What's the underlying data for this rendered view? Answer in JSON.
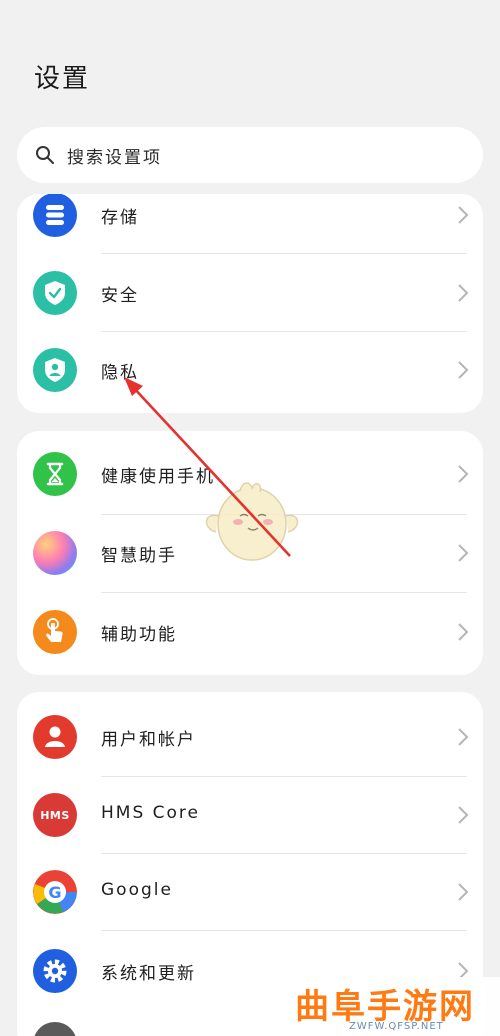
{
  "page": {
    "title": "设置"
  },
  "search": {
    "placeholder": "搜索设置项",
    "icon": "search-icon"
  },
  "group1": [
    {
      "label": "存储",
      "icon": "storage-icon",
      "color": "#1f5fe0"
    },
    {
      "label": "安全",
      "icon": "shield-check-icon",
      "color": "#2bbfa6"
    },
    {
      "label": "隐私",
      "icon": "privacy-shield-icon",
      "color": "#2bbfa6"
    }
  ],
  "group2": [
    {
      "label": "健康使用手机",
      "icon": "hourglass-icon",
      "color": "#31c24a"
    },
    {
      "label": "智慧助手",
      "icon": "assistant-orb-icon",
      "color": "#8a7cf0"
    },
    {
      "label": "辅助功能",
      "icon": "hand-tap-icon",
      "color": "#f48a1c"
    }
  ],
  "group3": [
    {
      "label": "用户和帐户",
      "icon": "user-icon",
      "color": "#e23b2e"
    },
    {
      "label": "HMS Core",
      "icon": "hms-icon",
      "color": "#d93a35",
      "icon_text": "HMS"
    },
    {
      "label": "Google",
      "icon": "google-icon",
      "color": "#ffffff"
    },
    {
      "label": "系统和更新",
      "icon": "gear-icon",
      "color": "#1f5fe0"
    }
  ],
  "watermark": {
    "main": "曲阜手游网",
    "sub": "ZWFW.QFSP.NET"
  }
}
